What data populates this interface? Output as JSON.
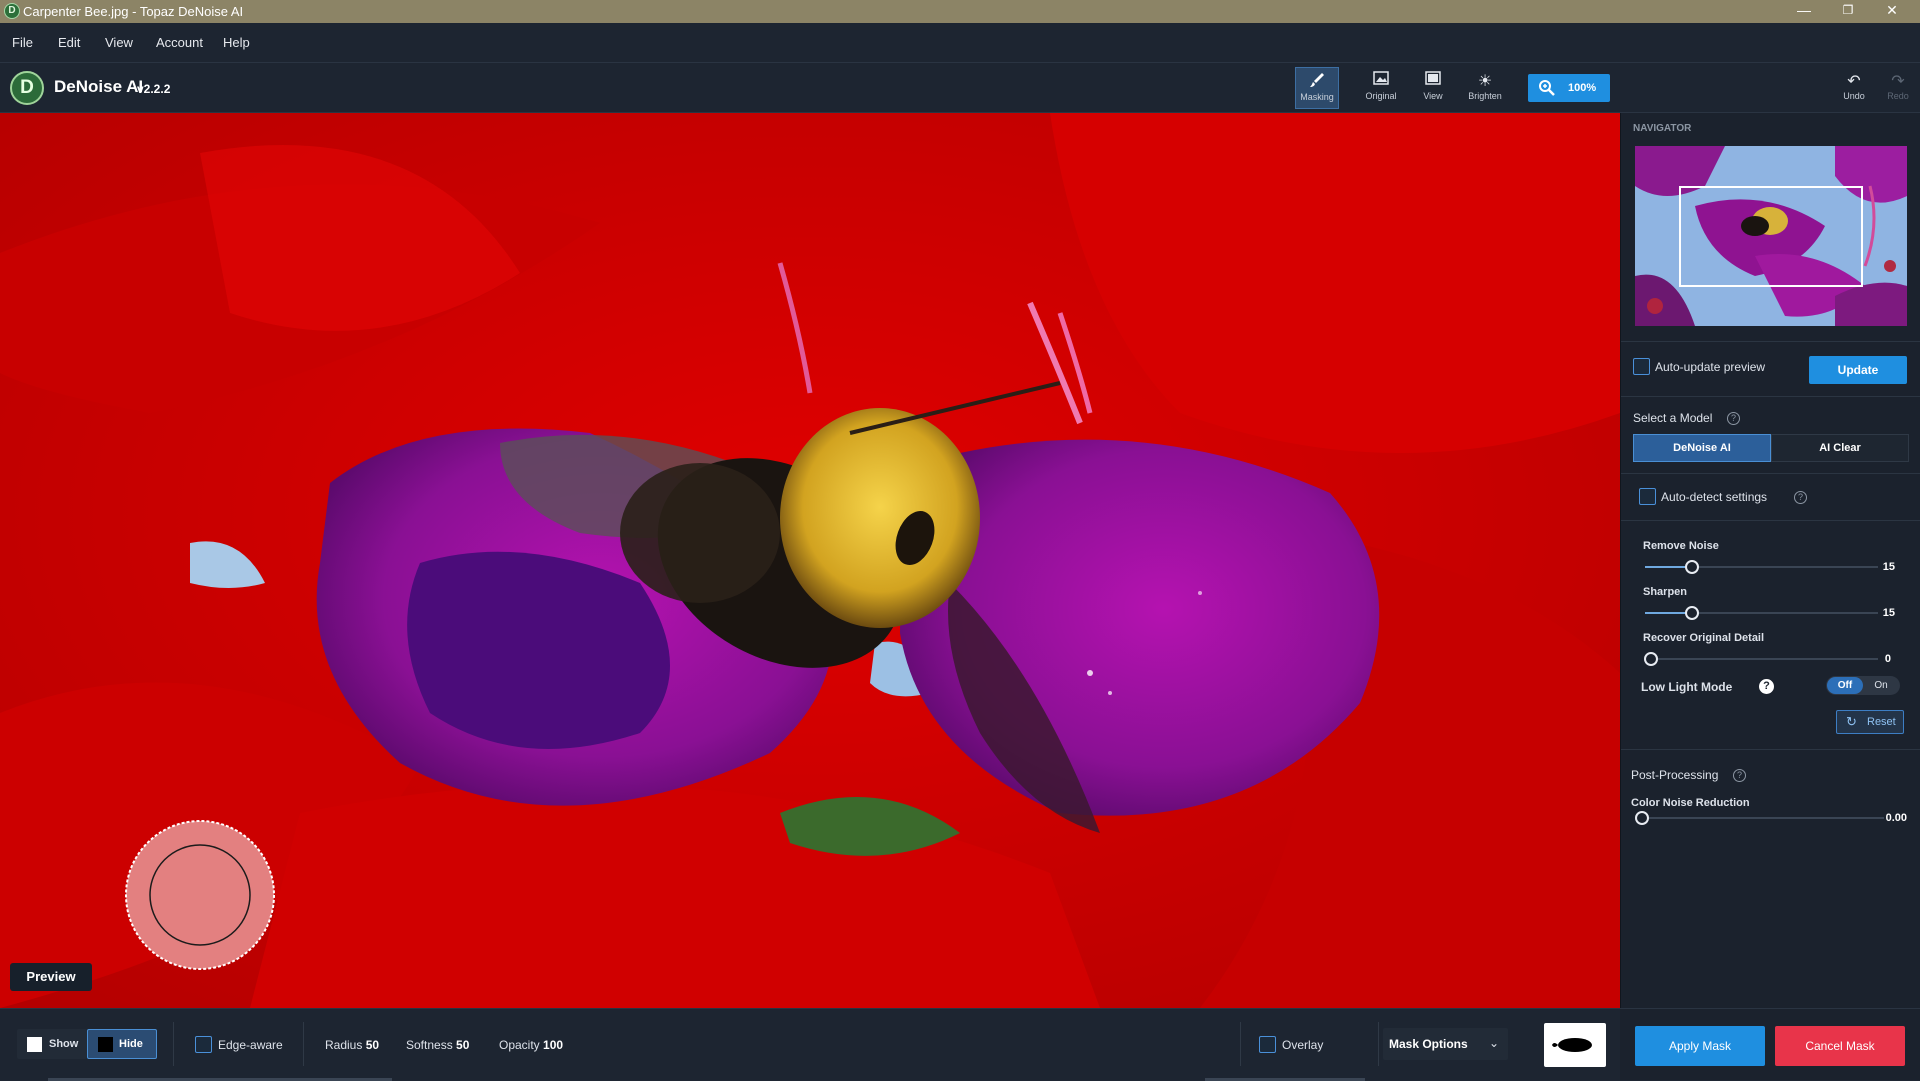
{
  "window": {
    "title": "Carpenter Bee.jpg - Topaz DeNoise AI",
    "app_icon": "D",
    "minimize": "—",
    "restore": "❐",
    "close": "✕"
  },
  "menu": [
    "File",
    "Edit",
    "View",
    "Account",
    "Help"
  ],
  "brand": {
    "logo": "D",
    "name": "DeNoise AI",
    "version": "v2.2.2"
  },
  "toolbar": {
    "masking": "Masking",
    "original": "Original",
    "view": "View",
    "brighten": "Brighten",
    "zoom": "100%",
    "undo": "Undo",
    "redo": "Redo"
  },
  "canvas": {
    "preview_label": "Preview"
  },
  "panel": {
    "navigator_title": "NAVIGATOR",
    "auto_update_label": "Auto-update preview",
    "update_button": "Update",
    "select_model_label": "Select a Model",
    "models": [
      "DeNoise AI",
      "AI Clear"
    ],
    "auto_detect_label": "Auto-detect settings",
    "sliders": [
      {
        "label": "Remove Noise",
        "value": "15",
        "fraction": 0.2
      },
      {
        "label": "Sharpen",
        "value": "15",
        "fraction": 0.2
      },
      {
        "label": "Recover Original Detail",
        "value": "0",
        "fraction": 0.0
      }
    ],
    "low_light_label": "Low Light Mode",
    "toggle_off": "Off",
    "toggle_on": "On",
    "reset_button": "Reset",
    "post_processing_label": "Post-Processing",
    "color_noise_label": "Color Noise Reduction",
    "color_noise_value": "0.00",
    "help_glyph": "?"
  },
  "bottom": {
    "show": "Show",
    "hide": "Hide",
    "edge_aware": "Edge-aware",
    "radius_label": "Radius",
    "radius_value": "50",
    "softness_label": "Softness",
    "softness_value": "50",
    "opacity_label": "Opacity",
    "opacity_value": "100",
    "overlay": "Overlay",
    "mask_options": "Mask Options",
    "apply_mask": "Apply Mask",
    "cancel_mask": "Cancel Mask"
  },
  "colors": {
    "accent": "#1f8fe0",
    "cancel": "#e8344a",
    "mask_red": "#d40000"
  }
}
